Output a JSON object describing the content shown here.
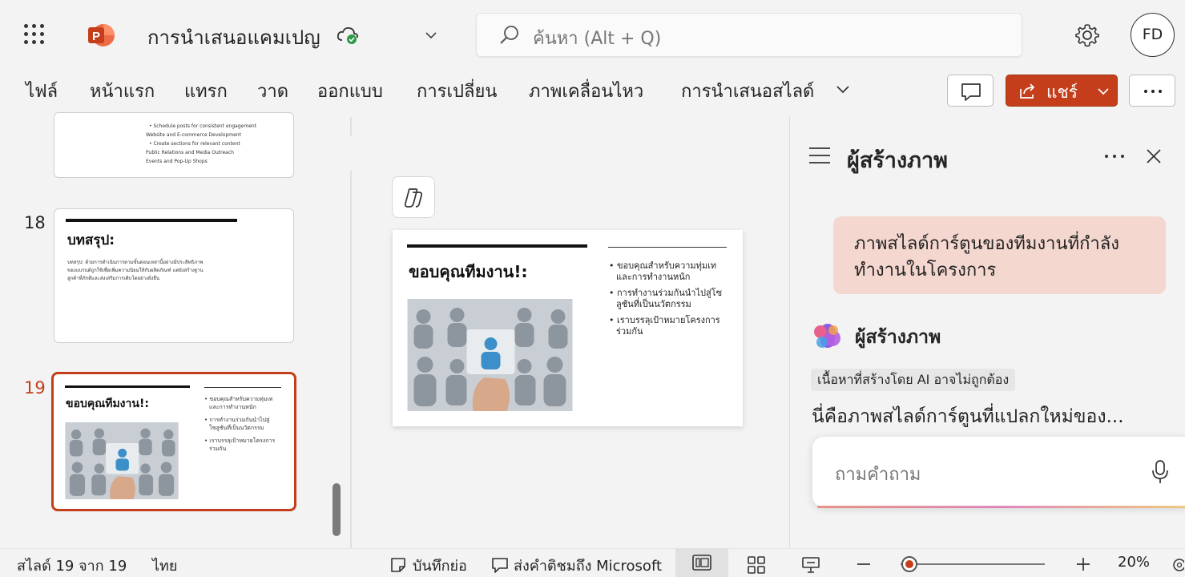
{
  "app": {
    "doc_title": "การนำเสนอแคมเปญ",
    "search_placeholder": "ค้นหา (Alt + Q)",
    "user_initials": "FD",
    "brand_color": "#c43e1c"
  },
  "ribbon": {
    "tabs": [
      "ไฟล์",
      "หน้าแรก",
      "แทรก",
      "วาด",
      "ออกแบบ",
      "การเปลี่ยน",
      "ภาพเคลื่อนไหว",
      "การนำเสนอสไลด์"
    ],
    "share_label": "แชร์"
  },
  "thumbnails": {
    "slide17_lines": [
      "• Schedule posts for consistent engagement",
      "Website and E-commerce Development",
      "• Create sections for relevant content",
      "Public Relations and Media Outreach",
      "Events and Pop-Up Shops"
    ],
    "slide18": {
      "number": "18",
      "title": "บทสรุป:",
      "body": [
        "บทสรุป: ด้วยการดำเนินการตามขั้นตอนเหล่านี้อย่างมีประสิทธิภาพ",
        "ของแบรนด์ถูกใช้เพื่อเพิ่มความนิยมให้กับผลิตภัณฑ์ แต่ยังสร้างฐาน",
        "ลูกค้าที่ภักดีและส่งเสริมการเติบโตอย่างยั่งยืน"
      ]
    },
    "slide19": {
      "number": "19",
      "title": "ขอบคุณทีมงาน!:",
      "bullets": [
        "ขอบคุณสำหรับความทุ่มเท",
        "และการทำงานหนัก",
        "การทำงานร่วมกันนำไปสู่",
        "โซลูชันที่เป็นนวัตกรรม",
        "เราบรรลุเป้าหมายโครงการ",
        "ร่วมกัน"
      ]
    }
  },
  "slide": {
    "title": "ขอบคุณทีมงาน!:",
    "bullets": [
      "ขอบคุณสำหรับความทุ่มเท\nและการทำงานหนัก",
      "การทำงานร่วมกันนำไปสู่โซ\nลูชันที่เป็นนวัตกรรม",
      "เราบรรลุเป้าหมายโครงการ\nร่วมกัน"
    ]
  },
  "copilot": {
    "pane_title": "ผู้สร้างภาพ",
    "user_prompt": "ภาพสไลด์การ์ตูนของทีมงานที่กำลังทำงานในโครงการ",
    "assistant_name": "ผู้สร้างภาพ",
    "ai_disclaimer": "เนื้อหาที่สร้างโดย AI อาจไม่ถูกต้อง",
    "response_preview": "นี่คือภาพสไลด์การ์ตูนที่แปลกใหม่ของ...",
    "ask_placeholder": "ถามคำถาม"
  },
  "statusbar": {
    "slide_pos": "สไลด์ 19 จาก 19",
    "language": "ไทย",
    "notes_label": "บันทึกย่อ",
    "feedback_label": "ส่งคำติชมถึง Microsoft",
    "zoom": "20%"
  }
}
